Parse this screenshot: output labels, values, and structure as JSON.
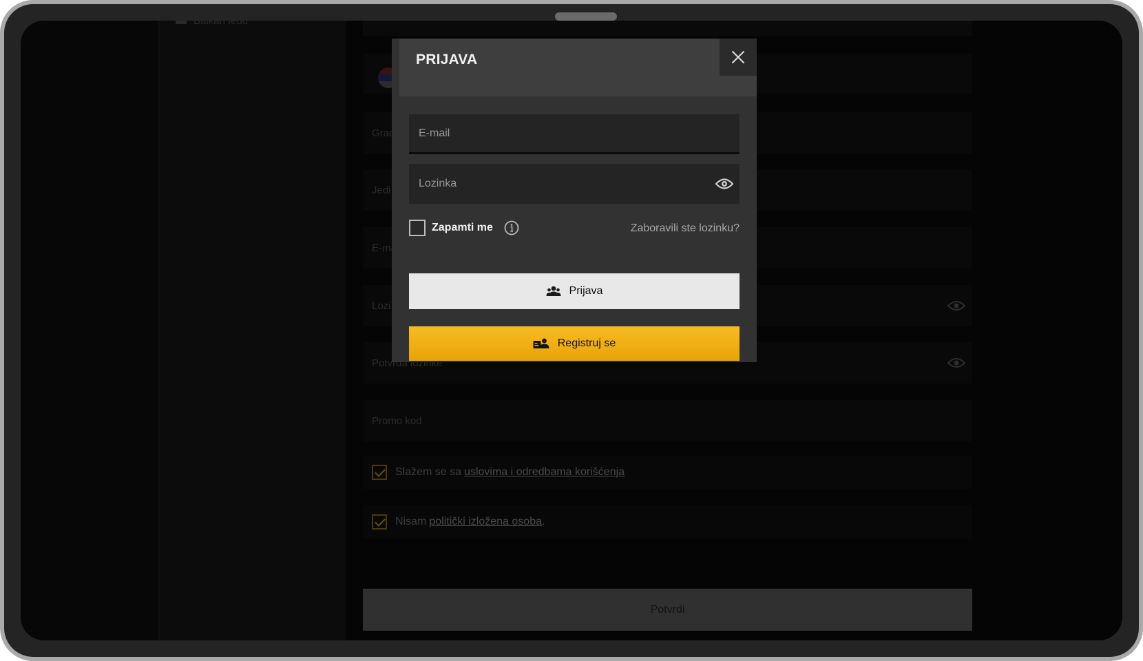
{
  "background_page": {
    "sidebar_link": "Balkan feud",
    "fields": [
      {
        "label": "Grad",
        "has_eye": false
      },
      {
        "label": "Jedi",
        "has_eye": false
      },
      {
        "label": "E-ma",
        "has_eye": false
      },
      {
        "label": "Lozi",
        "has_eye": true
      },
      {
        "label": "Potvrda lozinke",
        "has_eye": true
      },
      {
        "label": "Promo kod",
        "has_eye": false
      }
    ],
    "terms_text": "Slažem se sa",
    "terms_link": "uslovima i odredbama korišćenja",
    "pep_text": "Nisam",
    "pep_link": "politički izložena osoba",
    "pep_suffix": ".",
    "submit_label": "Potvrdi"
  },
  "modal": {
    "title": "PRIJAVA",
    "email_placeholder": "E-mail",
    "password_placeholder": "Lozinka",
    "remember_label": "Zapamti me",
    "forgot_label": "Zaboravili ste lozinku?",
    "login_label": "Prijava",
    "register_label": "Registruj se",
    "colors": {
      "accent": "#f5b41a",
      "login_bg": "#e8e8e8",
      "modal_bg": "#323232"
    },
    "icons": [
      "close-icon",
      "eye-icon",
      "info-icon",
      "users-icon",
      "user-card-icon"
    ]
  }
}
